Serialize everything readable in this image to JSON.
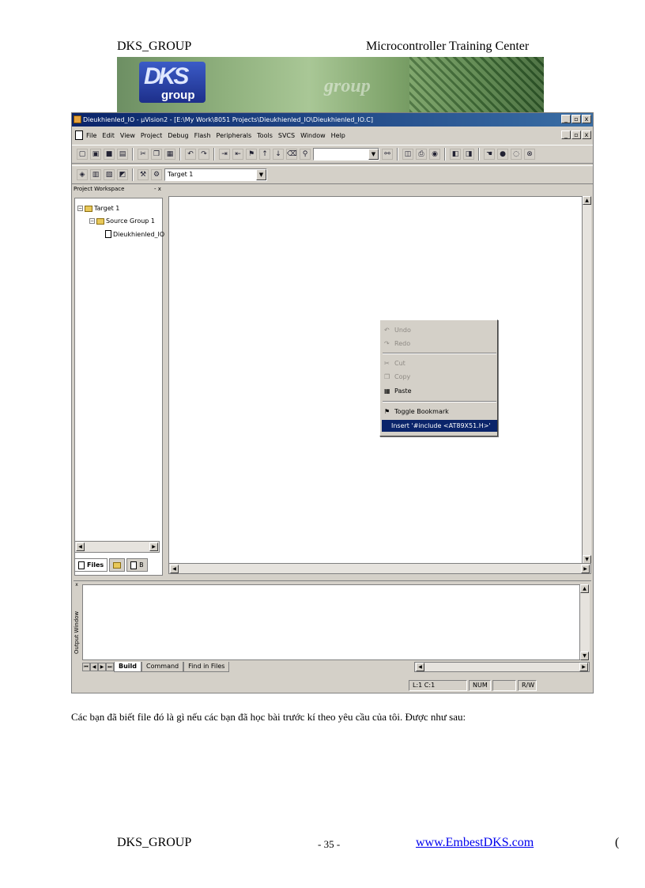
{
  "header": {
    "left": "DKS_GROUP",
    "right": "Microcontroller Training Center"
  },
  "banner": {
    "logo_letters": "DKS",
    "logo_word": "group",
    "watermark": "group"
  },
  "window": {
    "title": "Dieukhienled_IO - µVision2 - [E:\\My Work\\8051 Projects\\Dieukhienled_IO\\Dieukhienled_IO.C]",
    "buttons": {
      "minimize": "_",
      "restore": "▫",
      "close": "x"
    }
  },
  "menu": [
    "File",
    "Edit",
    "View",
    "Project",
    "Debug",
    "Flash",
    "Peripherals",
    "Tools",
    "SVCS",
    "Window",
    "Help"
  ],
  "toolbar2": {
    "target": "Target 1",
    "arrow": "▼"
  },
  "workspace": {
    "title": "Project Workspace",
    "close": "- x",
    "tree": {
      "target": "Target 1",
      "group": "Source Group 1",
      "file": "Dieukhienled_IO"
    },
    "tabs": {
      "files": "Files",
      "third": "B"
    }
  },
  "context_menu": {
    "undo": "Undo",
    "redo": "Redo",
    "cut": "Cut",
    "copy": "Copy",
    "paste": "Paste",
    "toggle_bookmark": "Toggle Bookmark",
    "insert_include": "Insert '#include <AT89X51.H>'"
  },
  "output": {
    "label": "Output Window",
    "close": "x",
    "tabs": [
      "Build",
      "Command",
      "Find in Files"
    ]
  },
  "status": {
    "position": "L:1 C:1",
    "num": "NUM",
    "rw": "R/W"
  },
  "body_text": "Các bạn đã biết file đó là gì nếu các bạn đã học bài trước kí theo yêu cầu của tôi. Được như sau:",
  "footer": {
    "left": "DKS_GROUP",
    "page": "- 35 -",
    "link": "www.EmbestDKS.com",
    "edge": "("
  }
}
